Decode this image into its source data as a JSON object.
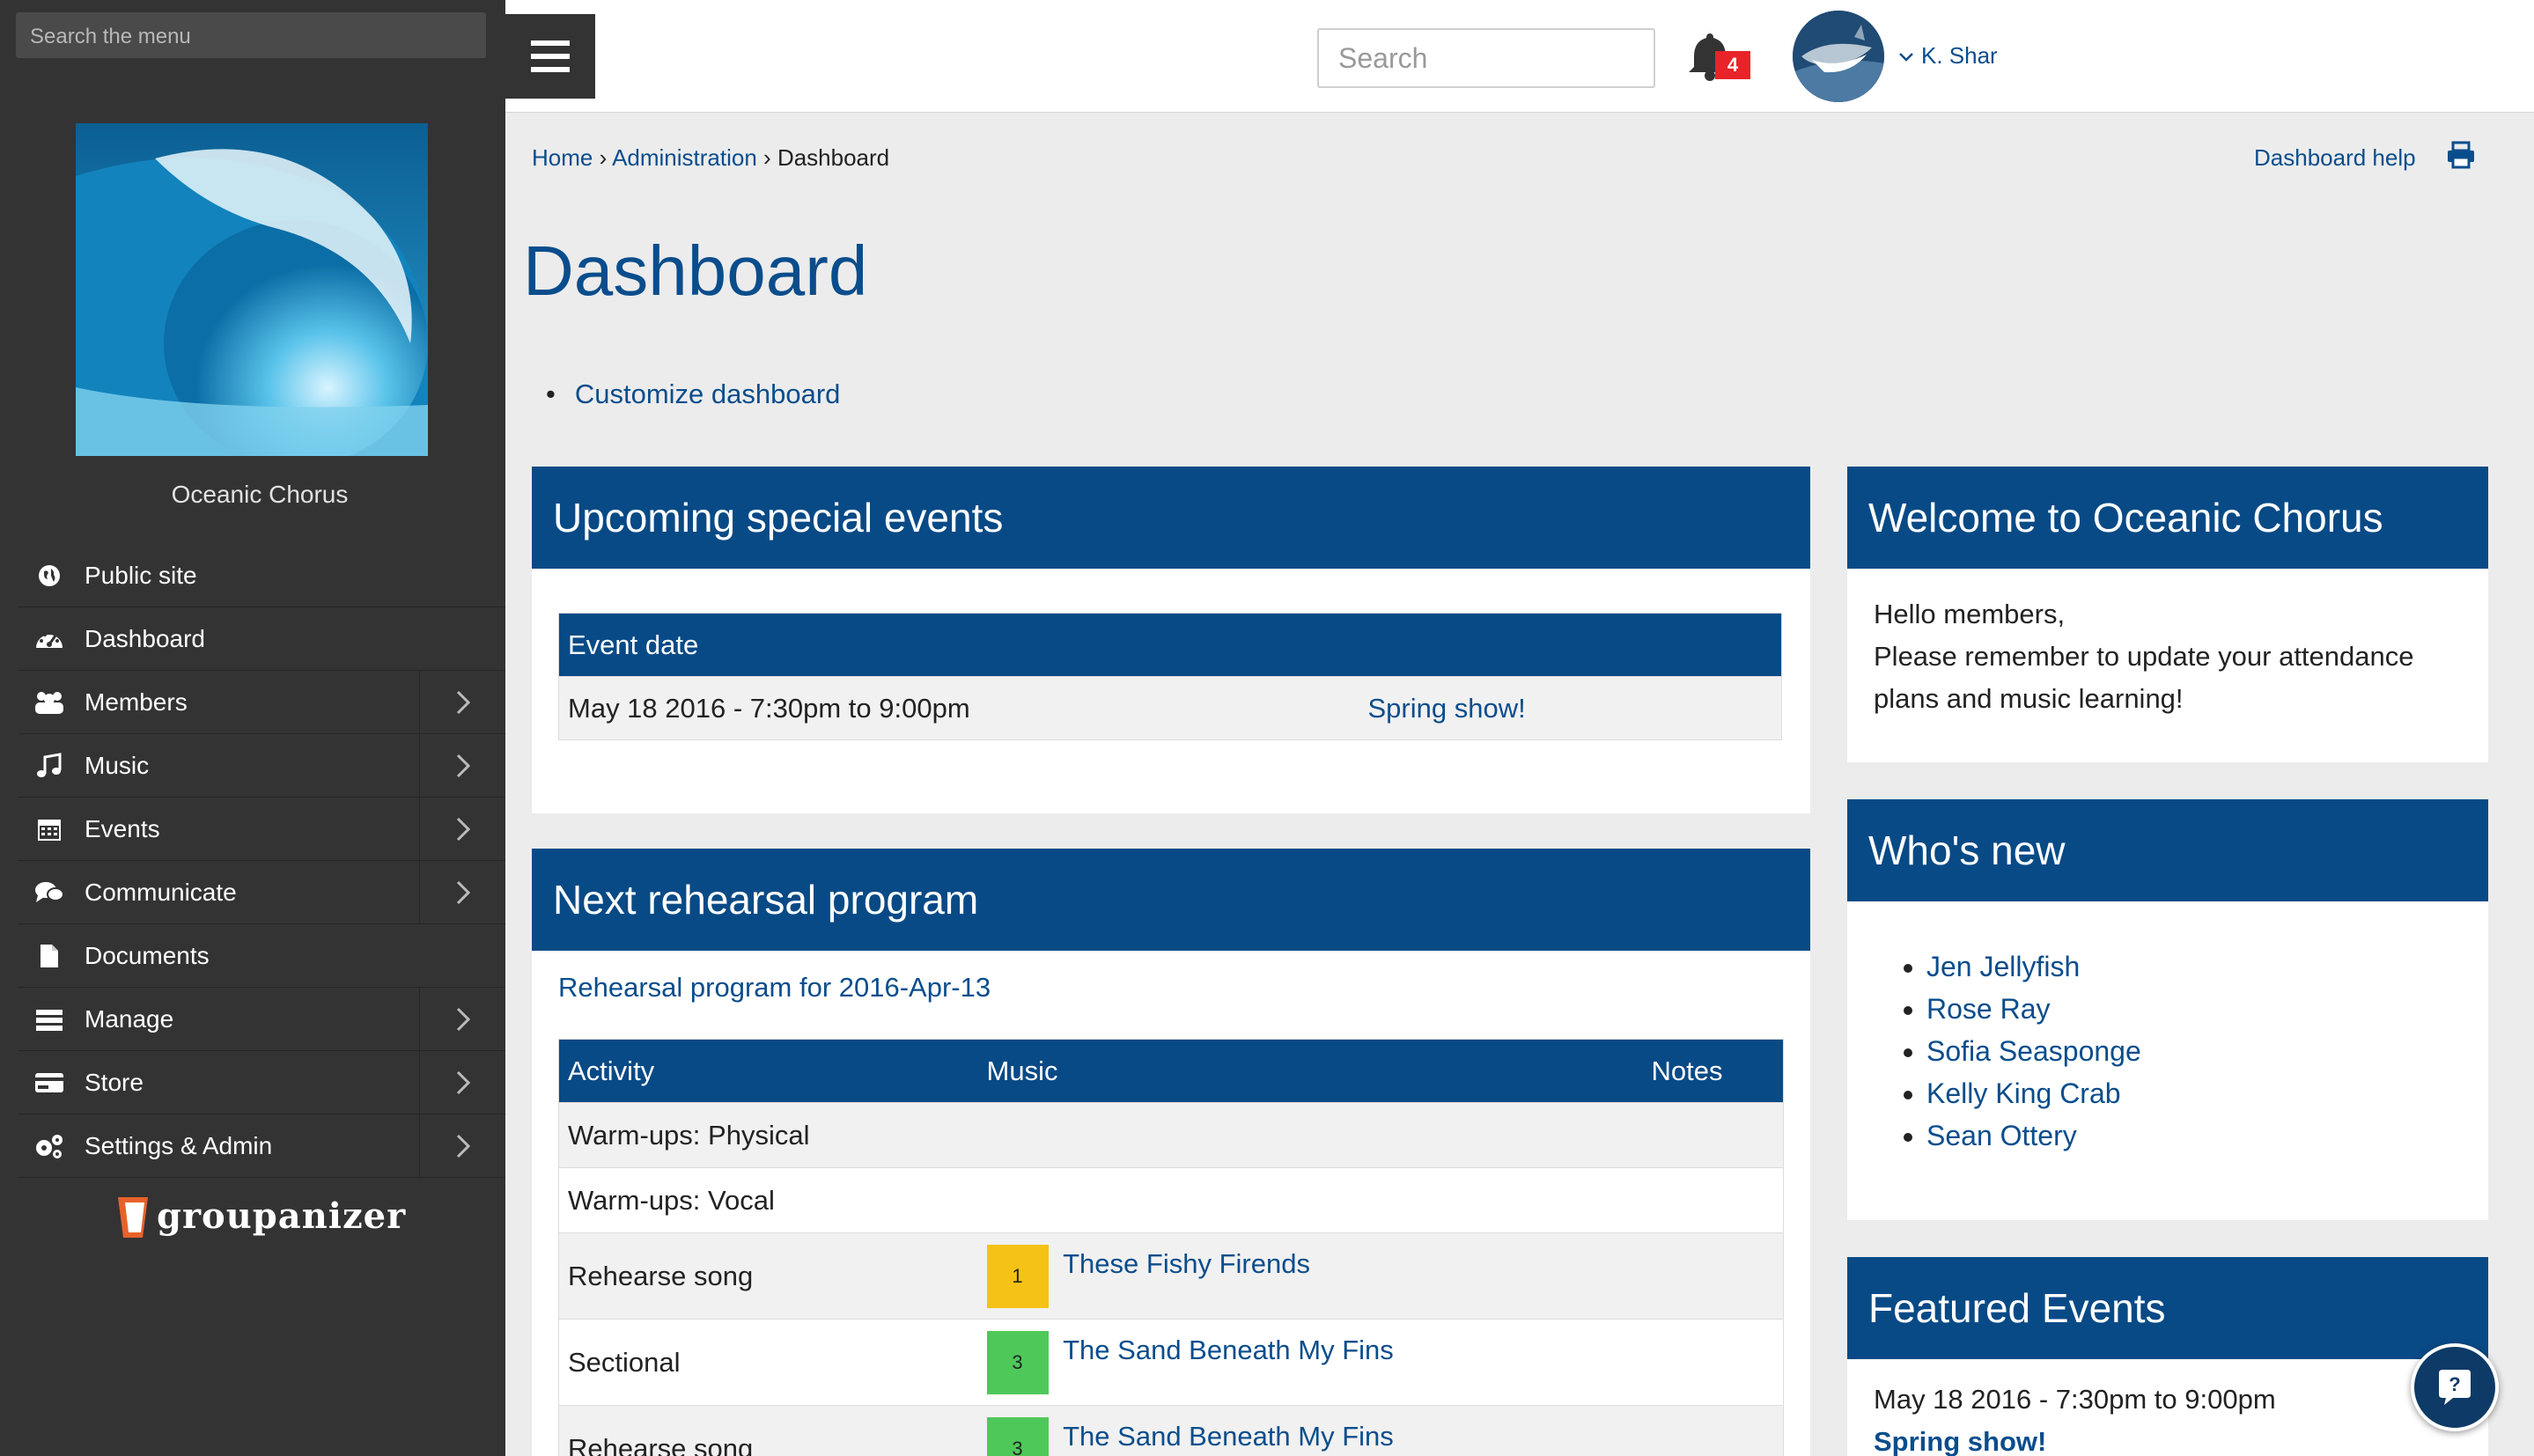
{
  "sidebar": {
    "search_placeholder": "Search the menu",
    "org_name": "Oceanic Chorus",
    "items": [
      {
        "label": "Public site",
        "icon": "globe-icon",
        "has_submenu": false
      },
      {
        "label": "Dashboard",
        "icon": "dashboard-icon",
        "has_submenu": false
      },
      {
        "label": "Members",
        "icon": "users-icon",
        "has_submenu": true
      },
      {
        "label": "Music",
        "icon": "music-icon",
        "has_submenu": true
      },
      {
        "label": "Events",
        "icon": "calendar-icon",
        "has_submenu": true
      },
      {
        "label": "Communicate",
        "icon": "chat-icon",
        "has_submenu": true
      },
      {
        "label": "Documents",
        "icon": "document-icon",
        "has_submenu": false
      },
      {
        "label": "Manage",
        "icon": "manage-icon",
        "has_submenu": true
      },
      {
        "label": "Store",
        "icon": "credit-card-icon",
        "has_submenu": true
      },
      {
        "label": "Settings & Admin",
        "icon": "gears-icon",
        "has_submenu": true
      }
    ],
    "brand": "groupanizer"
  },
  "topbar": {
    "search_placeholder": "Search",
    "notification_count": "4",
    "user_name": "K. Shar"
  },
  "breadcrumb": {
    "home": "Home",
    "sep": "›",
    "admin": "Administration",
    "current": "Dashboard"
  },
  "help_link": "Dashboard help",
  "page_title": "Dashboard",
  "customize_link": "Customize dashboard",
  "upcoming": {
    "title": "Upcoming special events",
    "column": "Event date",
    "rows": [
      {
        "date": "May 18 2016 - 7:30pm to 9:00pm",
        "event": "Spring show!"
      }
    ]
  },
  "rehearsal": {
    "title": "Next rehearsal program",
    "program_link": "Rehearsal program for 2016-Apr-13",
    "columns": [
      "Activity",
      "Music",
      "Notes"
    ],
    "rows": [
      {
        "activity": "Warm-ups: Physical",
        "chip": "",
        "music": "",
        "notes": ""
      },
      {
        "activity": "Warm-ups: Vocal",
        "chip": "",
        "music": "",
        "notes": ""
      },
      {
        "activity": "Rehearse song",
        "chip": "1",
        "music": "These Fishy Firends",
        "notes": ""
      },
      {
        "activity": "Sectional",
        "chip": "3",
        "music": "The Sand Beneath My Fins",
        "notes": ""
      },
      {
        "activity": "Rehearse song",
        "chip": "3",
        "music": "The Sand Beneath My Fins",
        "notes": ""
      }
    ],
    "chip_colors": {
      "1": "#f5c216",
      "3": "#4fc85a"
    }
  },
  "welcome": {
    "title": "Welcome to Oceanic Chorus",
    "line1": "Hello members,",
    "line2": "Please remember to update your attendance plans and music learning!"
  },
  "whos_new": {
    "title": "Who's new",
    "members": [
      "Jen Jellyfish",
      "Rose Ray",
      "Sofia Seasponge",
      "Kelly King Crab",
      "Sean Ottery"
    ]
  },
  "featured": {
    "title": "Featured Events",
    "date": "May 18 2016 - 7:30pm to 9:00pm",
    "event": "Spring show!"
  },
  "colors": {
    "primary": "#084a86",
    "link": "#0a4d8c",
    "sidebar_bg": "#333333",
    "badge": "#e8242a"
  }
}
